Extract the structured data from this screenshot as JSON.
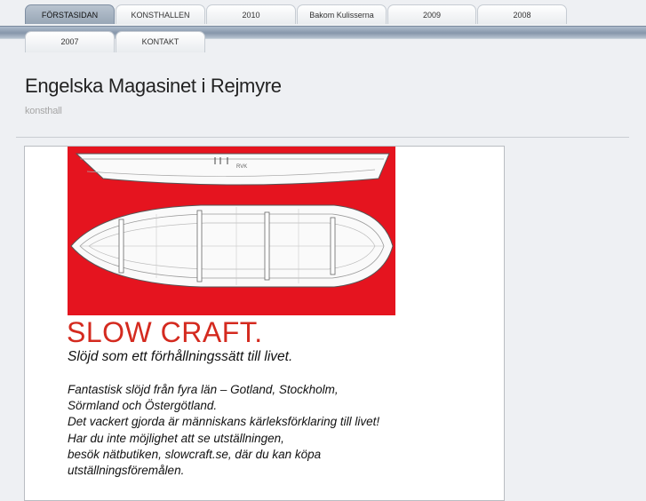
{
  "nav": {
    "tabs": [
      {
        "label": "FÖRSTASIDAN",
        "active": true
      },
      {
        "label": "KONSTHALLEN",
        "active": false
      },
      {
        "label": "2010",
        "active": false
      },
      {
        "label": "Bakom Kulisserna",
        "active": false
      },
      {
        "label": "2009",
        "active": false
      },
      {
        "label": "2008",
        "active": false
      },
      {
        "label": "2007",
        "active": false
      },
      {
        "label": "KONTAKT",
        "active": false
      }
    ]
  },
  "header": {
    "title": "Engelska Magasinet i Rejmyre",
    "subtitle": "konsthall"
  },
  "poster": {
    "image_label": "boat drawing on red background",
    "headline": "SLOW CRAFT.",
    "tagline": "Slöjd som ett förhållningssätt till livet.",
    "body_lines": [
      "Fantastisk slöjd från fyra län – Gotland, Stockholm,",
      "Sörmland och Östergötland.",
      "Det vackert gjorda är människans kärleksförklaring till livet!",
      "Har du inte möjlighet att se utställningen,",
      "besök nätbutiken, slowcraft.se, där du kan köpa",
      "utställningsföremålen."
    ],
    "accent_color": "#d42a1f",
    "background_color": "#e5141f"
  }
}
